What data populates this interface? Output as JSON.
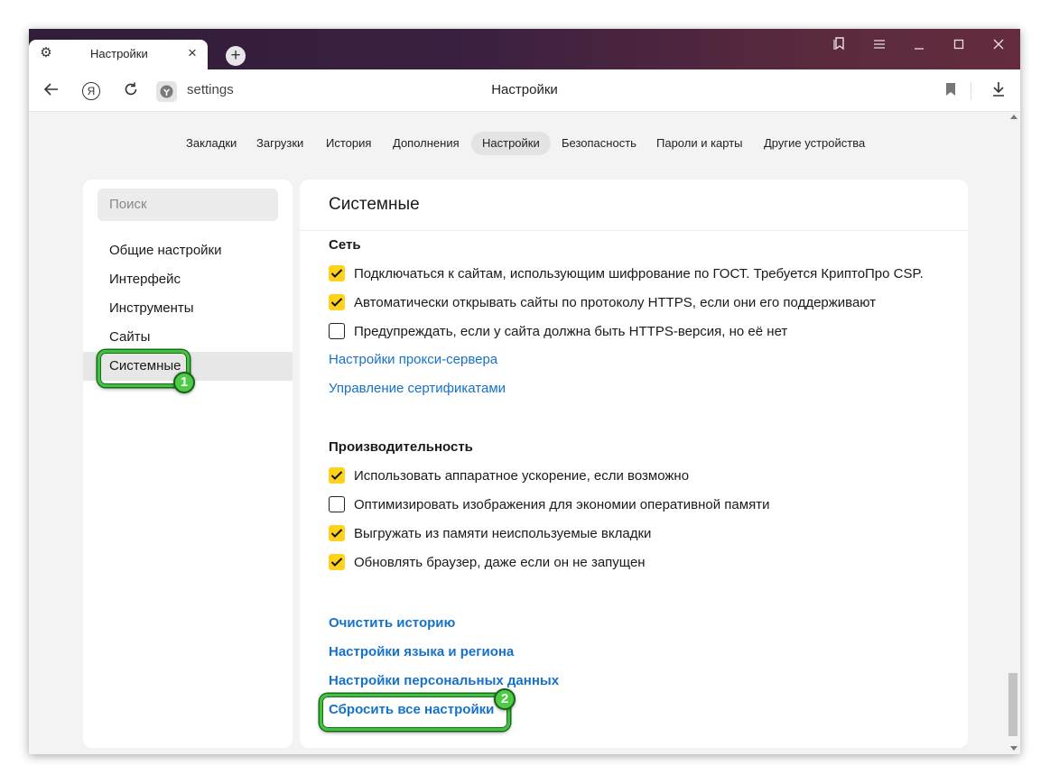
{
  "tab": {
    "title": "Настройки",
    "close": "×"
  },
  "newtab": "+",
  "toolbar": {
    "url": "settings",
    "page_title": "Настройки",
    "ya_letter": "Я"
  },
  "topnav": [
    {
      "label": "Закладки"
    },
    {
      "label": "Загрузки"
    },
    {
      "label": "История"
    },
    {
      "label": "Дополнения"
    },
    {
      "label": "Настройки",
      "active": true
    },
    {
      "label": "Безопасность"
    },
    {
      "label": "Пароли и карты"
    },
    {
      "label": "Другие устройства"
    }
  ],
  "sidebar": {
    "search_placeholder": "Поиск",
    "items": [
      {
        "label": "Общие настройки"
      },
      {
        "label": "Интерфейс"
      },
      {
        "label": "Инструменты"
      },
      {
        "label": "Сайты"
      },
      {
        "label": "Системные",
        "active": true
      }
    ]
  },
  "panel": {
    "title": "Системные",
    "network": {
      "title": "Сеть",
      "options": [
        {
          "label": "Подключаться к сайтам, использующим шифрование по ГОСТ. Требуется КриптоПро CSP.",
          "checked": true
        },
        {
          "label": "Автоматически открывать сайты по протоколу HTTPS, если они его поддерживают",
          "checked": true
        },
        {
          "label": "Предупреждать, если у сайта должна быть HTTPS-версия, но её нет",
          "checked": false
        }
      ],
      "links": [
        "Настройки прокси-сервера",
        "Управление сертификатами"
      ]
    },
    "performance": {
      "title": "Производительность",
      "options": [
        {
          "label": "Использовать аппаратное ускорение, если возможно",
          "checked": true
        },
        {
          "label": "Оптимизировать изображения для экономии оперативной памяти",
          "checked": false
        },
        {
          "label": "Выгружать из памяти неиспользуемые вкладки",
          "checked": true
        },
        {
          "label": "Обновлять браузер, даже если он не запущен",
          "checked": true
        }
      ]
    },
    "bottom_links": [
      "Очистить историю",
      "Настройки языка и региона",
      "Настройки персональных данных",
      "Сбросить все настройки"
    ]
  },
  "annotations": {
    "badge1": "1",
    "badge2": "2"
  },
  "colors": {
    "checkbox_on": "#ffd21f",
    "link": "#1672c9",
    "highlight": "#3fc23f"
  }
}
